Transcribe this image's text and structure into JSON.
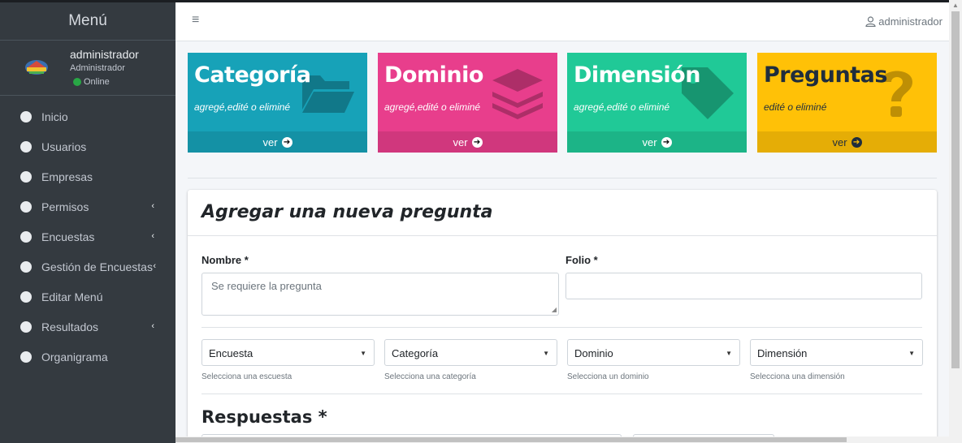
{
  "sidebar": {
    "brand": "Menú",
    "user": {
      "name": "administrador",
      "role": "Administrador",
      "status": "Online"
    },
    "items": [
      {
        "label": "Inicio",
        "has_submenu": false
      },
      {
        "label": "Usuarios",
        "has_submenu": false
      },
      {
        "label": "Empresas",
        "has_submenu": false
      },
      {
        "label": "Permisos",
        "has_submenu": true
      },
      {
        "label": "Encuestas",
        "has_submenu": true
      },
      {
        "label": "Gestión de Encuestas",
        "has_submenu": true
      },
      {
        "label": "Editar Menú",
        "has_submenu": false
      },
      {
        "label": "Resultados",
        "has_submenu": true
      },
      {
        "label": "Organigrama",
        "has_submenu": false
      }
    ],
    "caret": "‹"
  },
  "navbar": {
    "menu_icon": "≡",
    "user_label": "administrador"
  },
  "boxes": [
    {
      "title": "Categoría",
      "subtitle": "agregé,edité o eliminé",
      "footer": "ver",
      "icon": "folder-open-icon",
      "color": "#17a2b8"
    },
    {
      "title": "Dominio",
      "subtitle": "agregé,edité o eliminé",
      "footer": "ver",
      "icon": "layer-group-icon",
      "color": "#e83e8c"
    },
    {
      "title": "Dimensión",
      "subtitle": "agregé,edité o eliminé",
      "footer": "ver",
      "icon": "tag-icon",
      "color": "#20c997"
    },
    {
      "title": "Preguntas",
      "subtitle": "edité o eliminé",
      "footer": "ver",
      "icon": "question-icon",
      "color": "#ffc107"
    }
  ],
  "form": {
    "title": "Agregar una nueva pregunta",
    "nombre_label": "Nombre *",
    "nombre_placeholder": "Se requiere la pregunta",
    "folio_label": "Folio *",
    "folio_value": "",
    "selects": [
      {
        "value": "Encuesta",
        "help": "Selecciona una escuesta"
      },
      {
        "value": "Categoría",
        "help": "Selecciona una categoría"
      },
      {
        "value": "Dominio",
        "help": "Selecciona un dominio"
      },
      {
        "value": "Dimensión",
        "help": "Selecciona una dimensión"
      }
    ],
    "respuestas_heading": "Respuestas *"
  }
}
